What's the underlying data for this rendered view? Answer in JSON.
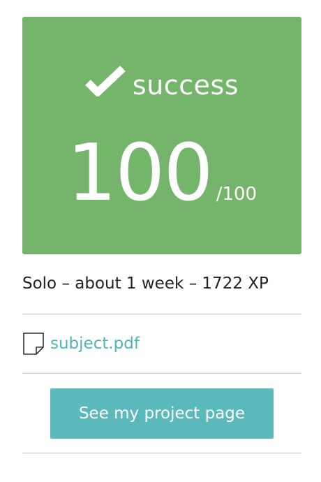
{
  "result": {
    "status_label": "success",
    "status_icon": "checkmark-icon",
    "score": "100",
    "score_max": "/100",
    "card_color": "#75b46b"
  },
  "project": {
    "meta": "Solo – about 1 week – 1722 XP"
  },
  "attachment": {
    "icon": "document-icon",
    "label": "subject.pdf",
    "link_color": "#50b5ba"
  },
  "actions": {
    "project_page_label": "See my project page",
    "button_color": "#5ab9bb"
  }
}
